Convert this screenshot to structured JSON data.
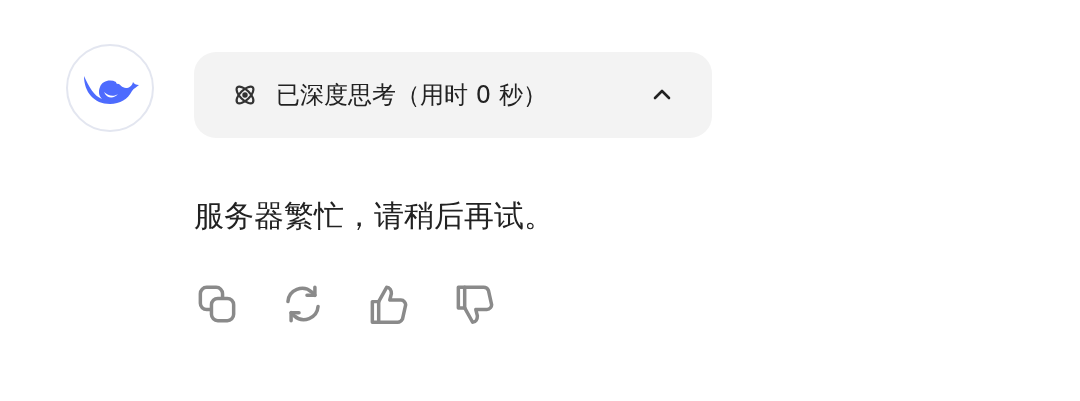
{
  "thinking": {
    "label": "已深度思考（用时 0 秒）",
    "expanded": true
  },
  "message": "服务器繁忙，请稍后再试。",
  "actions": [
    {
      "kind": "copy"
    },
    {
      "kind": "regenerate"
    },
    {
      "kind": "like"
    },
    {
      "kind": "dislike"
    }
  ]
}
